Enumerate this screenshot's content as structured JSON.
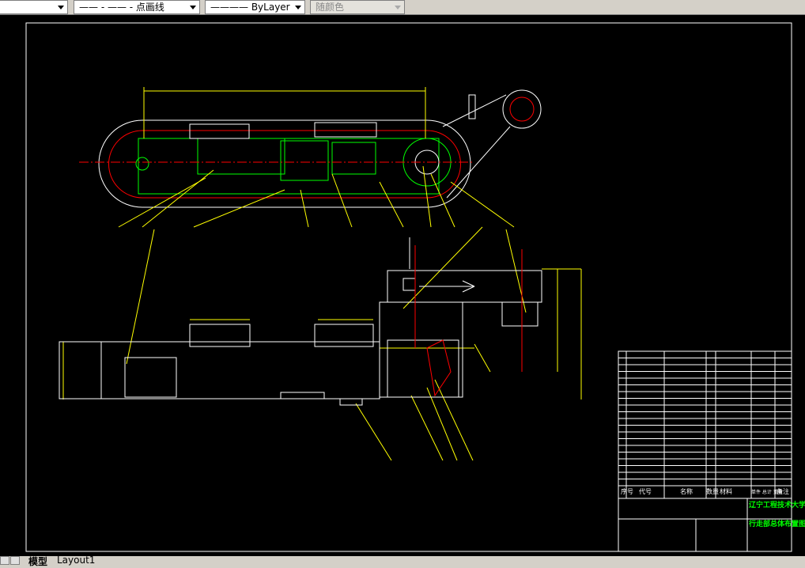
{
  "toolbar": {
    "layer_combo": "",
    "linetype_combo": "—— - —— - 点画线",
    "lineweight_combo": "———— ByLayer",
    "color_combo": "随颜色"
  },
  "tabs": [
    {
      "label": "模型"
    },
    {
      "label": "Layout1"
    }
  ],
  "title_block": {
    "school": "辽宁工程技术大学",
    "drawing_title": "行走部总体布置图",
    "headers": {
      "no": "序号",
      "code": "代号",
      "name": "名称",
      "qty": "数量",
      "material": "材料",
      "weight": "单件 总计 重量",
      "remark": "备注"
    }
  },
  "colors": {
    "background": "#000000",
    "outline": "#ffffff",
    "green": "#00ff00",
    "red": "#ff0000",
    "yellow": "#ffff00"
  }
}
